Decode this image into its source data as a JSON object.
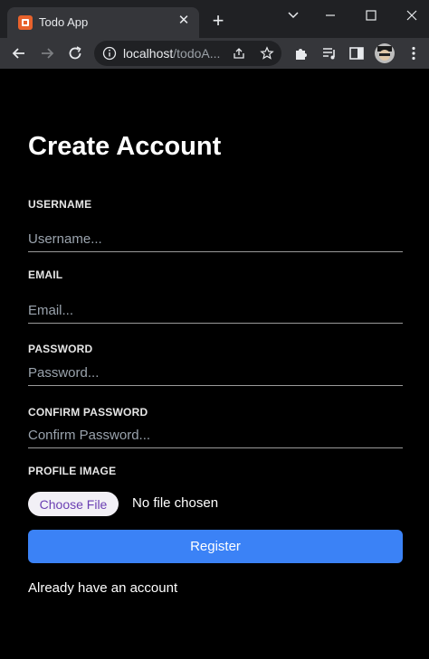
{
  "browser": {
    "tab_title": "Todo App",
    "url_host": "localhost",
    "url_path": "/todoA..."
  },
  "form": {
    "title": "Create Account",
    "username": {
      "label": "USERNAME",
      "placeholder": "Username..."
    },
    "email": {
      "label": "EMAIL",
      "placeholder": "Email..."
    },
    "password": {
      "label": "PASSWORD",
      "placeholder": "Password..."
    },
    "confirm_password": {
      "label": "CONFIRM PASSWORD",
      "placeholder": "Confirm Password..."
    },
    "profile_image": {
      "label": "PROFILE IMAGE",
      "button": "Choose File",
      "status": "No file chosen"
    },
    "register_button": "Register",
    "login_link": "Already have an account"
  },
  "colors": {
    "background": "#000000",
    "accent": "#3b82f6",
    "file_button_text": "#6b3fb3"
  },
  "icons": [
    "app-favicon-icon",
    "close-icon",
    "plus-icon",
    "chevron-down-icon",
    "minimize-icon",
    "maximize-icon",
    "window-close-icon",
    "back-arrow-icon",
    "forward-arrow-icon",
    "reload-icon",
    "info-icon",
    "share-icon",
    "star-icon",
    "extensions-icon",
    "media-icon",
    "sidepanel-icon",
    "menu-icon"
  ]
}
